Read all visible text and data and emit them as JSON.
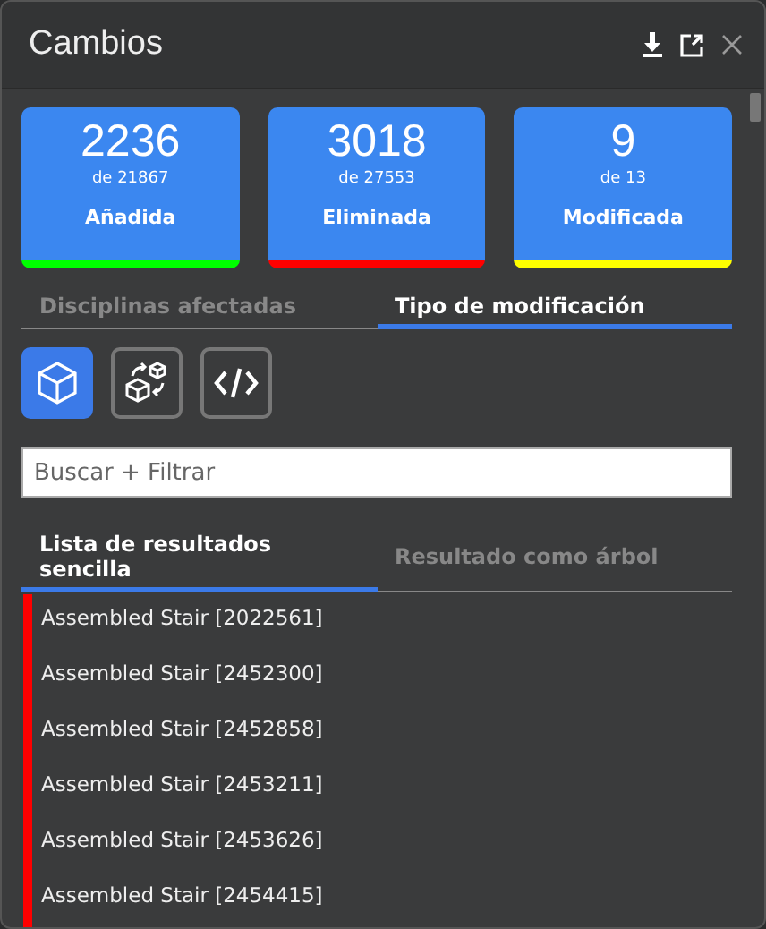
{
  "window": {
    "title": "Cambios"
  },
  "summary": [
    {
      "count": "2236",
      "total": "de 21867",
      "label": "Añadida",
      "color": "#00ff00"
    },
    {
      "count": "3018",
      "total": "de 27553",
      "label": "Eliminada",
      "color": "#ff0000"
    },
    {
      "count": "9",
      "total": "de 13",
      "label": "Modificada",
      "color": "#ffff00"
    }
  ],
  "tabs": [
    {
      "label": "Disciplinas afectadas",
      "selected": false
    },
    {
      "label": "Tipo de modificación",
      "selected": true
    }
  ],
  "view_buttons": [
    {
      "kind": "cube",
      "selected": true
    },
    {
      "kind": "swap",
      "selected": false
    },
    {
      "kind": "code",
      "selected": false
    }
  ],
  "search": {
    "placeholder": "Buscar + Filtrar"
  },
  "result_tabs": [
    {
      "label": "Lista de resultados sencilla",
      "selected": true
    },
    {
      "label": "Resultado como árbol",
      "selected": false
    }
  ],
  "results": [
    {
      "label": "Assembled Stair [2022561]",
      "color": "#ff0000"
    },
    {
      "label": "Assembled Stair [2452300]",
      "color": "#ff0000"
    },
    {
      "label": "Assembled Stair [2452858]",
      "color": "#ff0000"
    },
    {
      "label": "Assembled Stair [2453211]",
      "color": "#ff0000"
    },
    {
      "label": "Assembled Stair [2453626]",
      "color": "#ff0000"
    },
    {
      "label": "Assembled Stair [2454415]",
      "color": "#ff0000"
    }
  ]
}
